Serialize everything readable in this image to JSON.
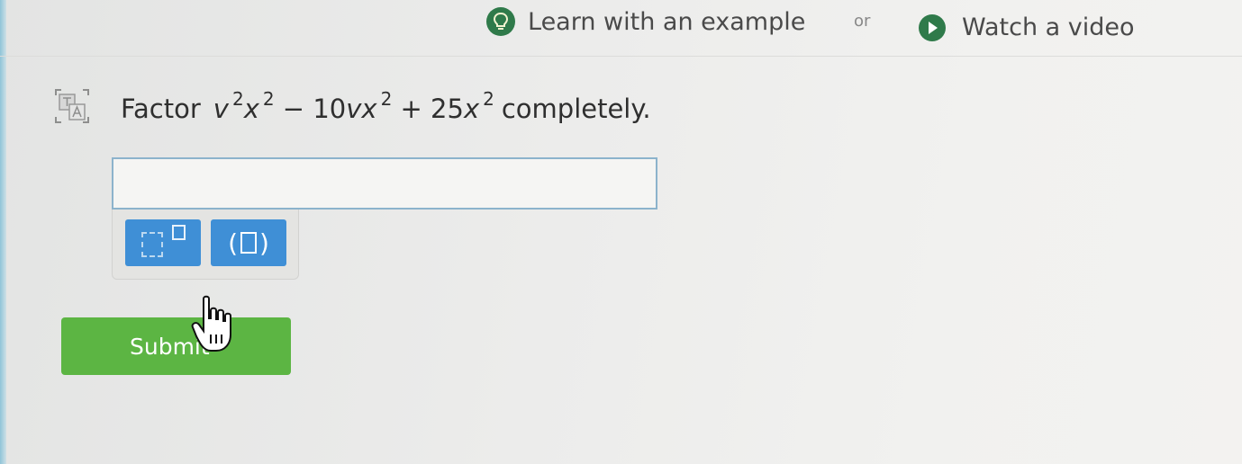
{
  "help_bar": {
    "example_label": "Learn with an example",
    "or_label": "or",
    "video_label": "Watch a video",
    "example_icon": "lightbulb-icon",
    "video_icon": "play-icon"
  },
  "question": {
    "translate_icon": "translate-icon",
    "prefix": "Factor",
    "expression": {
      "t1_var1": "v",
      "t1_exp1": "2",
      "t1_var2": "x",
      "t1_exp2": "2",
      "op1": " − 10",
      "t2_var": "vx",
      "t2_exp": "2",
      "op2": " + 25",
      "t3_var": "x",
      "t3_exp": "2"
    },
    "suffix": "completely."
  },
  "answer": {
    "value": "",
    "placeholder": ""
  },
  "palette": {
    "exponent_icon": "exponent-icon",
    "parentheses_icon": "parentheses-icon"
  },
  "submit": {
    "label": "Submit"
  },
  "colors": {
    "accent_green": "#2f7a4a",
    "submit_green": "#5cb543",
    "palette_blue": "#3f8fd6",
    "input_border": "#8cb3cc"
  }
}
